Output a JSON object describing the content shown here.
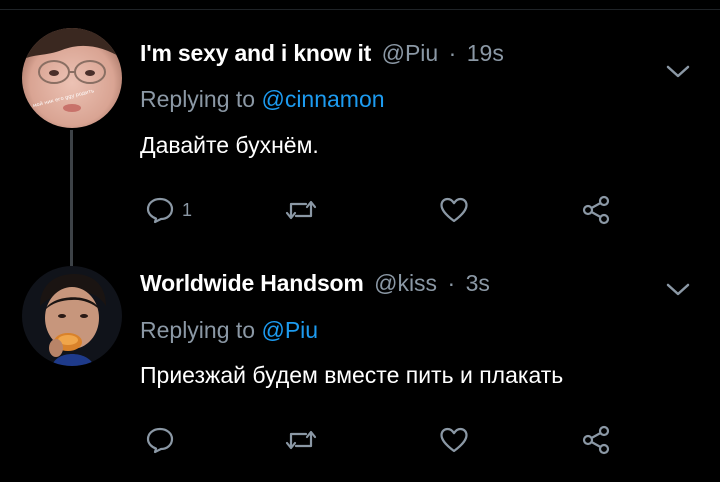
{
  "tweets": [
    {
      "display_name": "I'm sexy and i know it",
      "handle": "@Piu",
      "separator": "·",
      "time": "19s",
      "replying_prefix": "Replying to",
      "replying_handle": "@cinnamon",
      "text": "Давайте бухнём.",
      "reply_count": "1",
      "avatar_overlay_text": "мой ник его ggy родить"
    },
    {
      "display_name": "Worldwide Handsom",
      "handle": "@kiss",
      "separator": "·",
      "time": "3s",
      "replying_prefix": "Replying to",
      "replying_handle": "@Piu",
      "text": "Приезжай будем вместе пить и плакать",
      "reply_count": ""
    }
  ],
  "icons": {
    "caret": "chevron-down-icon",
    "reply": "reply-bubble-icon",
    "retweet": "retweet-icon",
    "like": "heart-icon",
    "share": "share-nodes-icon"
  },
  "colors": {
    "background": "#000000",
    "name": "#ffffff",
    "muted": "#8b98a5",
    "link": "#1d9bf0",
    "thread_line": "#3d4247"
  }
}
